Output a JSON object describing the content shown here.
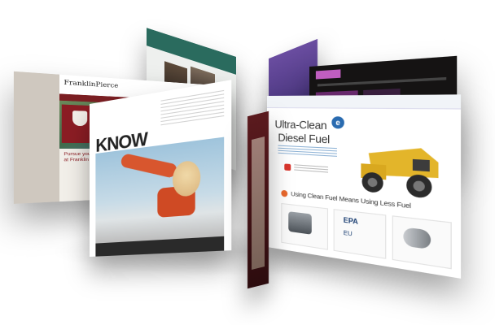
{
  "left_cluster": {
    "teal_page": {
      "band_text": ""
    },
    "franklin": {
      "logo": "FranklinPierce",
      "pursue_line1": "Pursue your passion",
      "pursue_line2": "at Franklin Pierce"
    },
    "know": {
      "word": "KNOW",
      "tagline": ""
    }
  },
  "right_cluster": {
    "ultra": {
      "title_line1": "Ultra-Clean",
      "title_line2": "Diesel Fuel",
      "mid_text": "Using Clean Fuel Means Using Less Fuel",
      "epa": "EPA",
      "eu": "EU"
    }
  },
  "colors": {
    "franklin_red": "#8b1c23",
    "ultra_blue": "#2a6bb0",
    "dark_site_accent": "#c05ec0"
  },
  "icons": [
    "e-logo-icon",
    "red-square-icon",
    "orange-circle-icon",
    "crest-icon",
    "engine-icon",
    "truck-icon"
  ]
}
